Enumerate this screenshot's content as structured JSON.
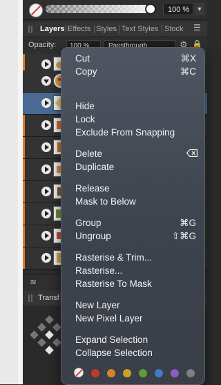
{
  "top_bar": {
    "opacity_value": "100 %"
  },
  "tabs": [
    {
      "label": "Layers",
      "active": true
    },
    {
      "label": "Effects",
      "active": false
    },
    {
      "label": "Styles",
      "active": false
    },
    {
      "label": "Text Styles",
      "active": false
    },
    {
      "label": "Stock",
      "active": false
    }
  ],
  "layers_panel": {
    "opacity_label": "Opacity:",
    "opacity_value": "100 %",
    "blend_mode": "Passthrough"
  },
  "transform_panel": {
    "tab_label": "Transf"
  },
  "context_menu": {
    "items": {
      "cut": {
        "label": "Cut",
        "shortcut": "⌘X"
      },
      "copy": {
        "label": "Copy",
        "shortcut": "⌘C"
      },
      "hide": {
        "label": "Hide"
      },
      "lock": {
        "label": "Lock"
      },
      "exclude": {
        "label": "Exclude From Snapping"
      },
      "delete": {
        "label": "Delete",
        "shortcut_icon": "delete-key-icon"
      },
      "duplicate": {
        "label": "Duplicate"
      },
      "release": {
        "label": "Release"
      },
      "mask_below": {
        "label": "Mask to Below"
      },
      "group": {
        "label": "Group",
        "shortcut": "⌘G"
      },
      "ungroup": {
        "label": "Ungroup",
        "shortcut": "⇧⌘G"
      },
      "rasterise_trim": {
        "label": "Rasterise & Trim..."
      },
      "rasterise": {
        "label": "Rasterise..."
      },
      "rasterise_mask": {
        "label": "Rasterise To Mask"
      },
      "new_layer": {
        "label": "New Layer"
      },
      "new_pixel_layer": {
        "label": "New Pixel Layer"
      },
      "expand_selection": {
        "label": "Expand Selection"
      },
      "collapse_selection": {
        "label": "Collapse Selection"
      }
    },
    "color_tags": [
      "#c0392b",
      "#d9822b",
      "#c9a227",
      "#5e9e3a",
      "#3f7bc6",
      "#8b5cc4",
      "#808080"
    ]
  },
  "colors": {
    "selection": "#4a6a93",
    "layer_accent": "#e07a27"
  }
}
